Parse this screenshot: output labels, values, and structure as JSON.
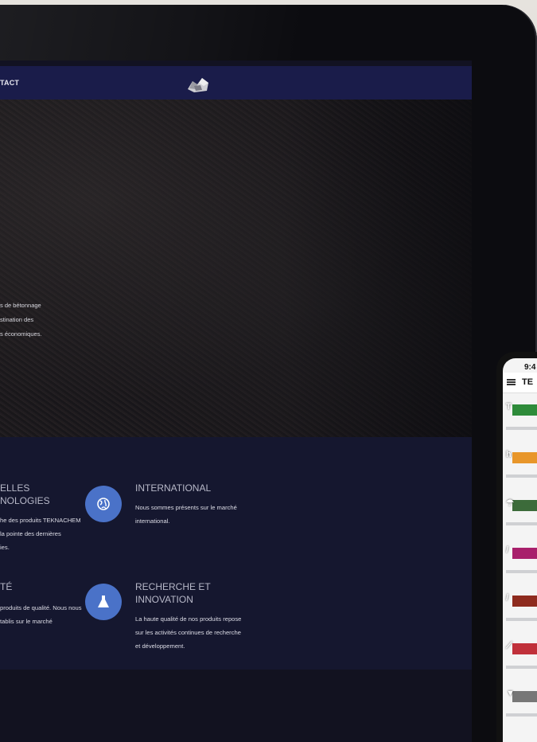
{
  "nav": {
    "link_contact": "TACT"
  },
  "hero": {
    "text_lines": [
      "s de bétonnage",
      "stination des",
      "s économiques."
    ]
  },
  "features": [
    {
      "title_lines": [
        "ELLES",
        "NOLOGIES"
      ],
      "text_lines": [
        "he des produits TEKNACHEM",
        "la pointe des dernières",
        "ies."
      ],
      "icon": "none"
    },
    {
      "title_lines": [
        "INTERNATIONAL"
      ],
      "text_lines": [
        "Nous sommes présents sur le marché",
        "international."
      ],
      "icon": "globe-icon"
    },
    {
      "title_lines": [
        "TÉ"
      ],
      "text_lines": [
        "produits de qualité. Nous nous",
        "tablis sur le marché"
      ],
      "icon": "none"
    },
    {
      "title_lines": [
        "RECHERCHE ET",
        "INNOVATION"
      ],
      "text_lines": [
        "La haute qualité de nos produits repose",
        "sur les activités continues de recherche",
        "et développement."
      ],
      "icon": "flask-icon"
    }
  ],
  "phone": {
    "time": "9:4",
    "brand": "TE",
    "rows": [
      {
        "color": "#2e8b3a",
        "glyph": "T"
      },
      {
        "color": "#e8962a",
        "glyph": "h"
      },
      {
        "color": "#3c6b3a",
        "glyph": "☂"
      },
      {
        "color": "#a81f6b",
        "glyph": "/"
      },
      {
        "color": "#8e2b1e",
        "glyph": "/"
      },
      {
        "color": "#c0303a",
        "glyph": "⟋"
      },
      {
        "color": "#777777",
        "glyph": "▼"
      }
    ]
  },
  "colors": {
    "nav_bg": "#1a1c4a",
    "features_bg": "#15172f",
    "icon_circle": "#4a72c8"
  }
}
